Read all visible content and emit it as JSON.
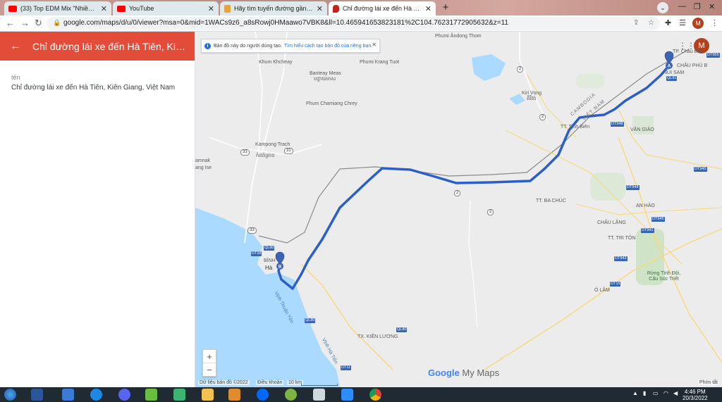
{
  "browser": {
    "tabs": [
      {
        "title": "(33) Top EDM Mix \"Nhiều Cảm Xú...",
        "favicon": "youtube-icon",
        "active": false
      },
      {
        "title": "YouTube",
        "favicon": "youtube-icon",
        "active": false
      },
      {
        "title": "Hãy tìm tuyến đường gần nhất đ...",
        "favicon": "document-icon",
        "active": false
      },
      {
        "title": "Chỉ đường lái xe đến Hà Tiên, Kiê...",
        "favicon": "mymaps-icon",
        "active": true
      }
    ],
    "url": "google.com/maps/d/u/0/viewer?msa=0&mid=1WACs9z6_a8sRowj0HMaawo7VBK8&ll=10.465941653823181%2C104.76231772905632&z=11",
    "profile_initial": "M"
  },
  "left_panel": {
    "header_title": "Chỉ đường lái xe đến Hà Tiên, Kiên G...",
    "field_label": "tên",
    "field_value": "Chỉ đường lái xe đến Hà Tiên, Kiên Giang, Việt Nam"
  },
  "map": {
    "notice_text": "Bản đồ này do người dùng tạo.",
    "notice_link": "Tìm hiểu cách tạo bản đồ của riêng bạn.",
    "marker_a": "A",
    "marker_b": "B",
    "zoom_in": "+",
    "zoom_out": "−",
    "brand_google": "Google",
    "brand_product": "My Maps",
    "footer_data": "Dữ liệu bản đồ ©2022",
    "footer_terms": "Điều khoản",
    "footer_scale": "10 km",
    "footer_shortcuts": "Phím tắt",
    "profile_initial": "M",
    "colors": {
      "route": "#2a5fc8",
      "water": "#aadaff",
      "land": "#ececec",
      "road": "#f8d97a",
      "border": "#8a8a8a"
    },
    "places": [
      {
        "name": "Phumi Ândong Thom"
      },
      {
        "name": "Khum Khcheay"
      },
      {
        "name": "Banteay Meas"
      },
      {
        "name": "បន្ទាយមាស"
      },
      {
        "name": "Phumi Krang Tuot"
      },
      {
        "name": "Kiri Vong"
      },
      {
        "name": "គិរីវង់"
      },
      {
        "name": "Phum Chamiang Chrey"
      },
      {
        "name": "Kampong Trach"
      },
      {
        "name": "កំពង់ត្រាច"
      },
      {
        "name": "amnak"
      },
      {
        "name": "ang Ise"
      },
      {
        "name": "CAMBODIA"
      },
      {
        "name": "VIỆT NAM"
      },
      {
        "name": "TT. Tịnh Biên"
      },
      {
        "name": "TP. Châu Đốc"
      },
      {
        "name": "CHÂU PHÚ B"
      },
      {
        "name": "NÚI SAM"
      },
      {
        "name": "VĂN GIÁO"
      },
      {
        "name": "TT. BA CHÚC"
      },
      {
        "name": "AN HẢO"
      },
      {
        "name": "CHÂU LĂNG"
      },
      {
        "name": "TT. TRI TÔN"
      },
      {
        "name": "Rừng Tỉnh Đội, Cấu Sóc Triết"
      },
      {
        "name": "Ô LÂM"
      },
      {
        "name": "BÌNH"
      },
      {
        "name": "Hà"
      },
      {
        "name": "Vịnh Thuận Yên"
      },
      {
        "name": "Vịnh Hà Tiên"
      },
      {
        "name": "TX. KIÊN LƯƠNG"
      }
    ],
    "shields": [
      "QL91",
      "DT948",
      "DT945",
      "DT948",
      "DT945",
      "DT943",
      "DT15",
      "QL80",
      "DT28",
      "QL80",
      "QL80",
      "DT11",
      "DT955",
      "DT941"
    ],
    "route_numbers": [
      "2",
      "2",
      "2",
      "2",
      "33",
      "31",
      "33"
    ]
  },
  "taskbar": {
    "time": "4:46 PM",
    "date": "20/3/2022"
  }
}
